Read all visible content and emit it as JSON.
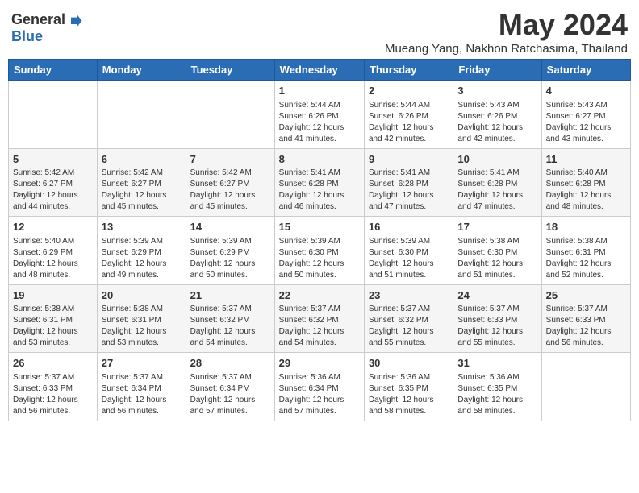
{
  "logo": {
    "general": "General",
    "blue": "Blue"
  },
  "title": {
    "month": "May 2024",
    "location": "Mueang Yang, Nakhon Ratchasima, Thailand"
  },
  "days_header": [
    "Sunday",
    "Monday",
    "Tuesday",
    "Wednesday",
    "Thursday",
    "Friday",
    "Saturday"
  ],
  "weeks": [
    [
      {
        "day": "",
        "info": ""
      },
      {
        "day": "",
        "info": ""
      },
      {
        "day": "",
        "info": ""
      },
      {
        "day": "1",
        "info": "Sunrise: 5:44 AM\nSunset: 6:26 PM\nDaylight: 12 hours\nand 41 minutes."
      },
      {
        "day": "2",
        "info": "Sunrise: 5:44 AM\nSunset: 6:26 PM\nDaylight: 12 hours\nand 42 minutes."
      },
      {
        "day": "3",
        "info": "Sunrise: 5:43 AM\nSunset: 6:26 PM\nDaylight: 12 hours\nand 42 minutes."
      },
      {
        "day": "4",
        "info": "Sunrise: 5:43 AM\nSunset: 6:27 PM\nDaylight: 12 hours\nand 43 minutes."
      }
    ],
    [
      {
        "day": "5",
        "info": "Sunrise: 5:42 AM\nSunset: 6:27 PM\nDaylight: 12 hours\nand 44 minutes."
      },
      {
        "day": "6",
        "info": "Sunrise: 5:42 AM\nSunset: 6:27 PM\nDaylight: 12 hours\nand 45 minutes."
      },
      {
        "day": "7",
        "info": "Sunrise: 5:42 AM\nSunset: 6:27 PM\nDaylight: 12 hours\nand 45 minutes."
      },
      {
        "day": "8",
        "info": "Sunrise: 5:41 AM\nSunset: 6:28 PM\nDaylight: 12 hours\nand 46 minutes."
      },
      {
        "day": "9",
        "info": "Sunrise: 5:41 AM\nSunset: 6:28 PM\nDaylight: 12 hours\nand 47 minutes."
      },
      {
        "day": "10",
        "info": "Sunrise: 5:41 AM\nSunset: 6:28 PM\nDaylight: 12 hours\nand 47 minutes."
      },
      {
        "day": "11",
        "info": "Sunrise: 5:40 AM\nSunset: 6:28 PM\nDaylight: 12 hours\nand 48 minutes."
      }
    ],
    [
      {
        "day": "12",
        "info": "Sunrise: 5:40 AM\nSunset: 6:29 PM\nDaylight: 12 hours\nand 48 minutes."
      },
      {
        "day": "13",
        "info": "Sunrise: 5:39 AM\nSunset: 6:29 PM\nDaylight: 12 hours\nand 49 minutes."
      },
      {
        "day": "14",
        "info": "Sunrise: 5:39 AM\nSunset: 6:29 PM\nDaylight: 12 hours\nand 50 minutes."
      },
      {
        "day": "15",
        "info": "Sunrise: 5:39 AM\nSunset: 6:30 PM\nDaylight: 12 hours\nand 50 minutes."
      },
      {
        "day": "16",
        "info": "Sunrise: 5:39 AM\nSunset: 6:30 PM\nDaylight: 12 hours\nand 51 minutes."
      },
      {
        "day": "17",
        "info": "Sunrise: 5:38 AM\nSunset: 6:30 PM\nDaylight: 12 hours\nand 51 minutes."
      },
      {
        "day": "18",
        "info": "Sunrise: 5:38 AM\nSunset: 6:31 PM\nDaylight: 12 hours\nand 52 minutes."
      }
    ],
    [
      {
        "day": "19",
        "info": "Sunrise: 5:38 AM\nSunset: 6:31 PM\nDaylight: 12 hours\nand 53 minutes."
      },
      {
        "day": "20",
        "info": "Sunrise: 5:38 AM\nSunset: 6:31 PM\nDaylight: 12 hours\nand 53 minutes."
      },
      {
        "day": "21",
        "info": "Sunrise: 5:37 AM\nSunset: 6:32 PM\nDaylight: 12 hours\nand 54 minutes."
      },
      {
        "day": "22",
        "info": "Sunrise: 5:37 AM\nSunset: 6:32 PM\nDaylight: 12 hours\nand 54 minutes."
      },
      {
        "day": "23",
        "info": "Sunrise: 5:37 AM\nSunset: 6:32 PM\nDaylight: 12 hours\nand 55 minutes."
      },
      {
        "day": "24",
        "info": "Sunrise: 5:37 AM\nSunset: 6:33 PM\nDaylight: 12 hours\nand 55 minutes."
      },
      {
        "day": "25",
        "info": "Sunrise: 5:37 AM\nSunset: 6:33 PM\nDaylight: 12 hours\nand 56 minutes."
      }
    ],
    [
      {
        "day": "26",
        "info": "Sunrise: 5:37 AM\nSunset: 6:33 PM\nDaylight: 12 hours\nand 56 minutes."
      },
      {
        "day": "27",
        "info": "Sunrise: 5:37 AM\nSunset: 6:34 PM\nDaylight: 12 hours\nand 56 minutes."
      },
      {
        "day": "28",
        "info": "Sunrise: 5:37 AM\nSunset: 6:34 PM\nDaylight: 12 hours\nand 57 minutes."
      },
      {
        "day": "29",
        "info": "Sunrise: 5:36 AM\nSunset: 6:34 PM\nDaylight: 12 hours\nand 57 minutes."
      },
      {
        "day": "30",
        "info": "Sunrise: 5:36 AM\nSunset: 6:35 PM\nDaylight: 12 hours\nand 58 minutes."
      },
      {
        "day": "31",
        "info": "Sunrise: 5:36 AM\nSunset: 6:35 PM\nDaylight: 12 hours\nand 58 minutes."
      },
      {
        "day": "",
        "info": ""
      }
    ]
  ]
}
